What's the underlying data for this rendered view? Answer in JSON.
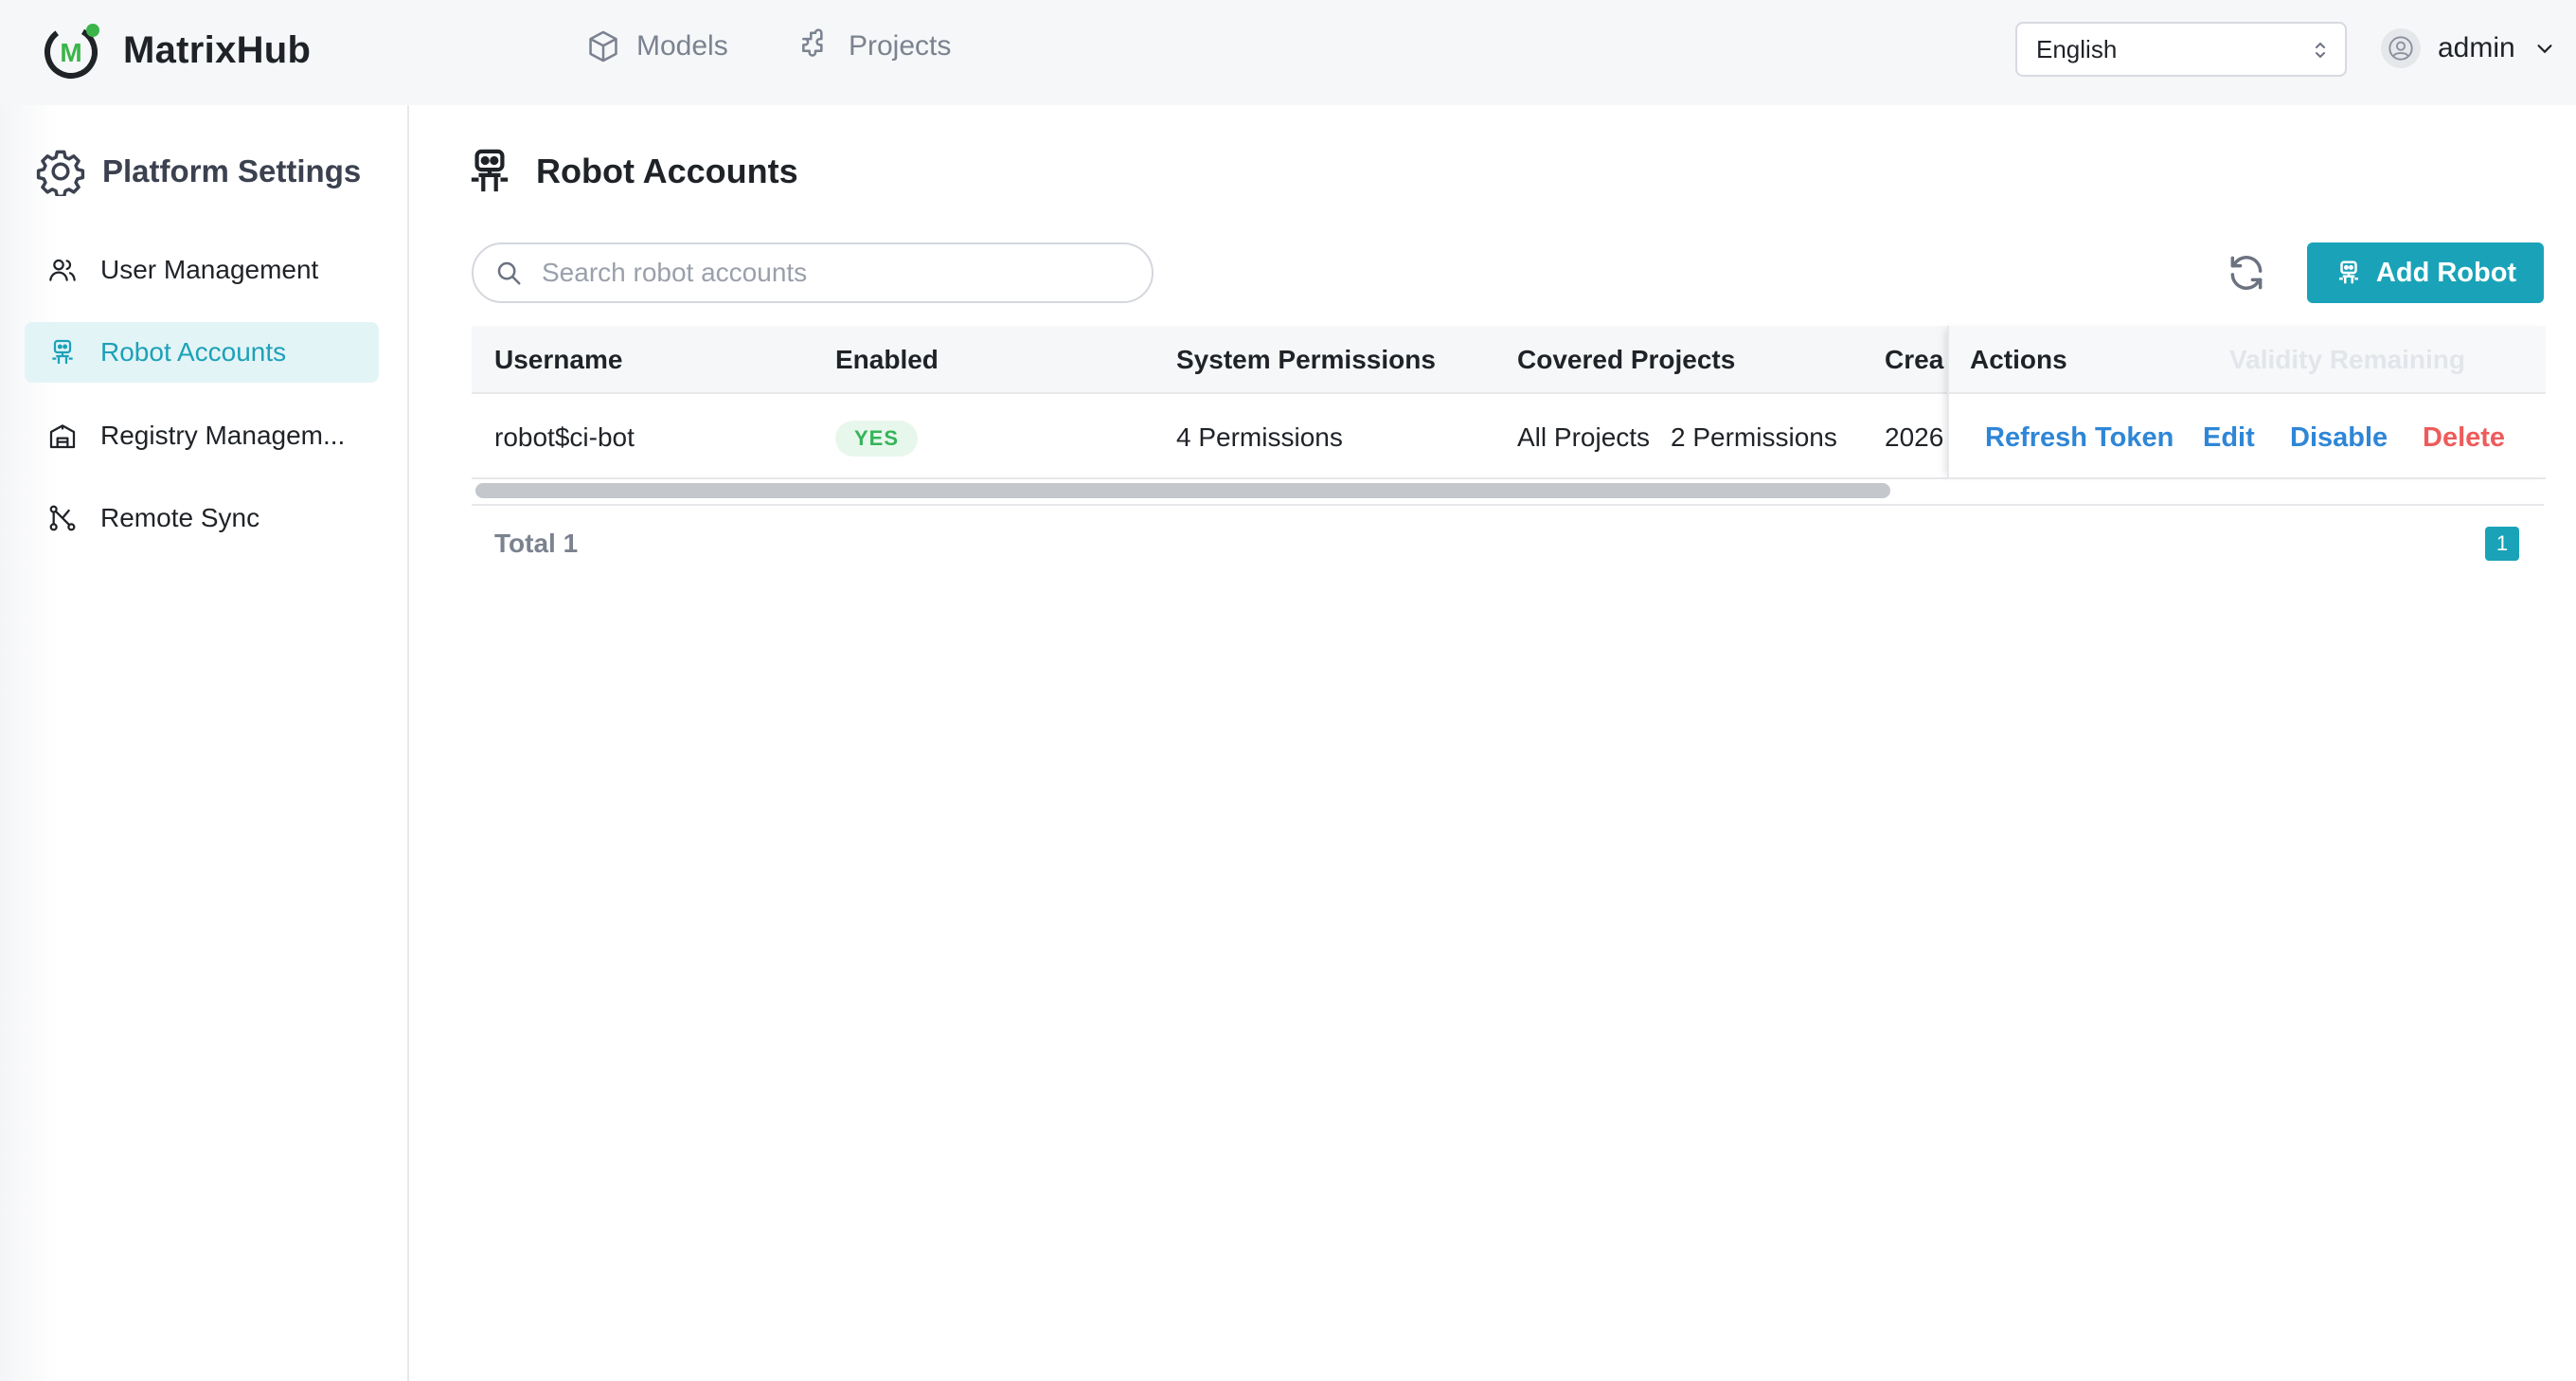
{
  "app": {
    "name": "MatrixHub",
    "brand_color": "#1aa3b8",
    "logo_letter": "M"
  },
  "header": {
    "nav": [
      {
        "label": "Models",
        "icon": "cube-icon"
      },
      {
        "label": "Projects",
        "icon": "puzzle-icon"
      }
    ],
    "language": {
      "selected": "English"
    },
    "user": {
      "name": "admin"
    }
  },
  "sidebar": {
    "title": "Platform Settings",
    "items": [
      {
        "label": "User Management",
        "icon": "users-icon",
        "active": false
      },
      {
        "label": "Robot Accounts",
        "icon": "robot-icon",
        "active": true
      },
      {
        "label": "Registry Managem...",
        "icon": "building-icon",
        "active": false
      },
      {
        "label": "Remote Sync",
        "icon": "sync-nodes-icon",
        "active": false
      }
    ]
  },
  "main": {
    "title": "Robot Accounts",
    "search": {
      "placeholder": "Search robot accounts",
      "value": ""
    },
    "add_button": "Add Robot",
    "table": {
      "columns": [
        "Username",
        "Enabled",
        "System Permissions",
        "Covered Projects",
        "Crea",
        "Actions"
      ],
      "hidden_column": "Validity Remaining",
      "rows": [
        {
          "username": "robot$ci-bot",
          "enabled": "YES",
          "system_permissions": "4 Permissions",
          "covered_projects_scope": "All Projects",
          "covered_projects_perms": "2 Permissions",
          "created_partial": "2026"
        }
      ],
      "actions": {
        "refresh": "Refresh Token",
        "edit": "Edit",
        "disable": "Disable",
        "delete": "Delete"
      },
      "scroll_position": 0.0
    },
    "pagination": {
      "total": "Total 1",
      "current_page": "1"
    }
  },
  "colors": {
    "accent": "#1aa3b8",
    "link": "#2f86d6",
    "danger": "#ee5b5b",
    "success": "#35b45a",
    "active_bg": "#e3f4f7"
  }
}
